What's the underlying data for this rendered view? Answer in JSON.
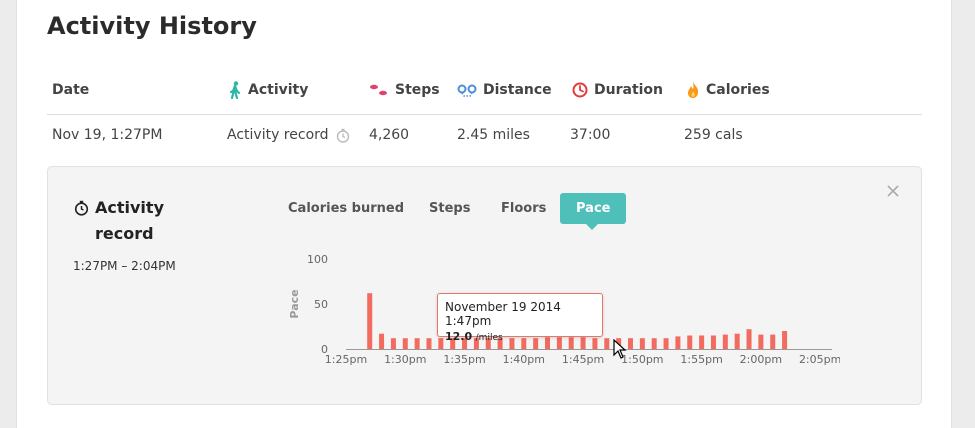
{
  "page": {
    "title": "Activity History"
  },
  "table": {
    "headers": {
      "date": "Date",
      "activity": "Activity",
      "steps": "Steps",
      "distance": "Distance",
      "duration": "Duration",
      "calories": "Calories"
    },
    "row": {
      "date": "Nov 19, 1:27PM",
      "activity": "Activity record",
      "steps": "4,260",
      "distance": "2.45 miles",
      "duration": "37:00",
      "calories": "259 cals"
    },
    "icons": {
      "activity": "walking-person-icon",
      "steps": "footprints-icon",
      "distance": "route-pins-icon",
      "duration": "clock-icon",
      "calories": "flame-icon",
      "row_activity": "stopwatch-icon"
    }
  },
  "detail": {
    "title_line1": "Activity",
    "title_line2": "record",
    "time_range": "1:27PM – 2:04PM",
    "tabs": [
      "Calories burned",
      "Steps",
      "Floors",
      "Pace"
    ],
    "active_tab": "Pace",
    "close_icon": "close-icon"
  },
  "chart_data": {
    "type": "bar",
    "ylabel": "Pace",
    "ylim": [
      0,
      100
    ],
    "yticks": [
      0,
      50,
      100
    ],
    "x_tick_labels": [
      "1:25pm",
      "1:30pm",
      "1:35pm",
      "1:40pm",
      "1:45pm",
      "1:50pm",
      "1:55pm",
      "2:00pm",
      "2:05pm"
    ],
    "x_tick_minutes": [
      0,
      5,
      10,
      15,
      20,
      25,
      30,
      35,
      40
    ],
    "minute_range": [
      0,
      41
    ],
    "values_per_minute": [
      [
        2,
        62
      ],
      [
        3,
        17
      ],
      [
        4,
        12
      ],
      [
        5,
        12
      ],
      [
        6,
        12
      ],
      [
        7,
        12
      ],
      [
        8,
        12
      ],
      [
        9,
        12
      ],
      [
        10,
        12
      ],
      [
        11,
        12
      ],
      [
        12,
        12
      ],
      [
        13,
        12
      ],
      [
        14,
        12
      ],
      [
        15,
        12
      ],
      [
        16,
        12
      ],
      [
        17,
        13
      ],
      [
        18,
        13
      ],
      [
        19,
        13
      ],
      [
        20,
        13
      ],
      [
        21,
        12
      ],
      [
        22,
        12
      ],
      [
        23,
        12
      ],
      [
        24,
        12
      ],
      [
        25,
        12
      ],
      [
        26,
        12
      ],
      [
        27,
        12
      ],
      [
        28,
        14
      ],
      [
        29,
        15
      ],
      [
        30,
        15
      ],
      [
        31,
        15
      ],
      [
        32,
        16
      ],
      [
        33,
        17
      ],
      [
        34,
        22
      ],
      [
        35,
        16
      ],
      [
        36,
        16
      ],
      [
        37,
        20
      ]
    ],
    "color": "#f26b5e",
    "tooltip": {
      "title": "November 19 2014 1:47pm",
      "value": "12.0",
      "unit": "/miles"
    }
  },
  "colors": {
    "tab_active": "#4fc0b9",
    "bar": "#f26b5e",
    "activity_icon": "#2bb7a6",
    "steps_icon": "#e0436c",
    "distance_icon": "#4a90d9",
    "duration_icon": "#e23b3b",
    "calories_icon": "#f59a1b"
  }
}
